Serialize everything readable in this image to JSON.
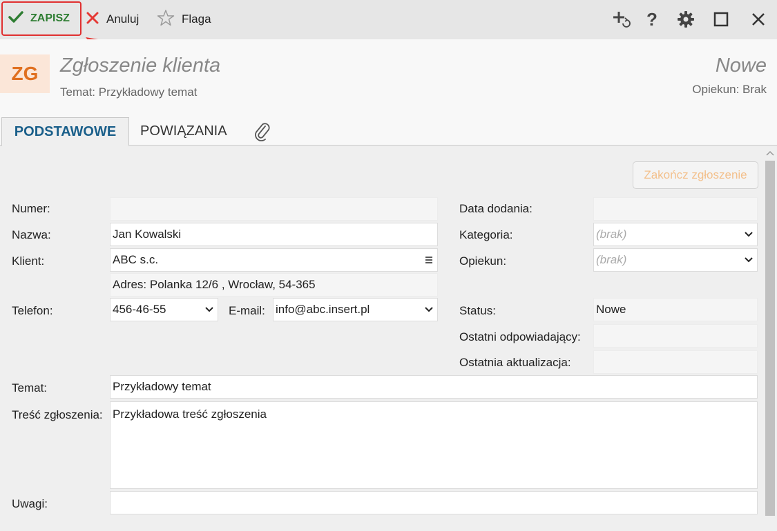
{
  "toolbar": {
    "save_label": "ZAPISZ",
    "cancel_label": "Anuluj",
    "flag_label": "Flaga",
    "help_symbol": "?"
  },
  "header": {
    "avatar": "ZG",
    "title": "Zgłoszenie klienta",
    "subtitle": "Temat: Przykładowy temat",
    "status": "Nowe",
    "owner": "Opiekun: Brak"
  },
  "tabs": [
    {
      "label": "PODSTAWOWE"
    },
    {
      "label": "POWIĄZANIA"
    }
  ],
  "form": {
    "finish_button": "Zakończ zgłoszenie",
    "numer": {
      "label": "Numer:",
      "value": ""
    },
    "nazwa": {
      "label": "Nazwa:",
      "value": "Jan Kowalski"
    },
    "klient": {
      "label": "Klient:",
      "value": "ABC s.c."
    },
    "adres": "Adres:  Polanka  12/6 , Wrocław, 54-365",
    "telefon": {
      "label": "Telefon:",
      "value": "456-46-55"
    },
    "email": {
      "label": "E-mail:",
      "value": "info@abc.insert.pl"
    },
    "data_dodania": {
      "label": "Data dodania:",
      "value": ""
    },
    "kategoria": {
      "label": "Kategoria:",
      "placeholder": "(brak)"
    },
    "opiekun": {
      "label": "Opiekun:",
      "placeholder": "(brak)"
    },
    "status": {
      "label": "Status:",
      "value": "Nowe"
    },
    "ostatni_odp": {
      "label": "Ostatni odpowiadający:",
      "value": ""
    },
    "ostatnia_akt": {
      "label": "Ostatnia aktualizacja:",
      "value": ""
    },
    "temat": {
      "label": "Temat:",
      "value": "Przykładowy temat"
    },
    "tresc": {
      "label": "Treść zgłoszenia:",
      "value": "Przykładowa treść zgłoszenia"
    },
    "uwagi": {
      "label": "Uwagi:",
      "value": ""
    }
  },
  "colors": {
    "accent_tab": "#1a5f8a",
    "save_green": "#2e7d32",
    "highlight_red": "#e03030",
    "avatar_orange": "#e07020"
  }
}
